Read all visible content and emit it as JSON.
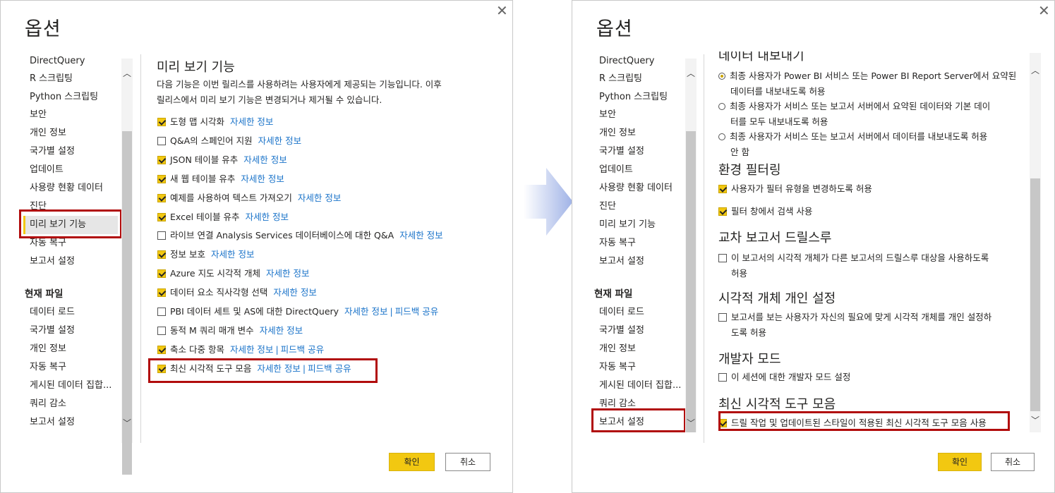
{
  "dialog1": {
    "title": "옵션",
    "nav_global": [
      "DirectQuery",
      "R 스크립팅",
      "Python 스크립팅",
      "보안",
      "개인 정보",
      "국가별 설정",
      "업데이트",
      "사용량 현황 데이터",
      "진단",
      "미리 보기 기능",
      "자동 복구",
      "보고서 설정"
    ],
    "nav_current_header": "현재 파일",
    "nav_current": [
      "데이터 로드",
      "국가별 설정",
      "개인 정보",
      "자동 복구",
      "게시된 데이터 집합...",
      "쿼리 감소",
      "보고서 설정"
    ],
    "selected_nav": "미리 보기 기능",
    "section_title": "미리 보기 기능",
    "description": [
      "다음 기능은 이번 릴리스를 사용하려는 사용자에게 제공되는 기능입니다. 이후",
      "릴리스에서 미리 보기 기능은 변경되거나 제거될 수 있습니다."
    ],
    "features": [
      {
        "label": "도형 맵 시각화",
        "checked": true,
        "link": "자세한 정보",
        "feedback": ""
      },
      {
        "label": "Q&A의 스페인어 지원",
        "checked": false,
        "link": "자세한 정보",
        "feedback": ""
      },
      {
        "label": "JSON 테이블 유추",
        "checked": true,
        "link": "자세한 정보",
        "feedback": ""
      },
      {
        "label": "새 웹 테이블 유추",
        "checked": true,
        "link": "자세한 정보",
        "feedback": ""
      },
      {
        "label": "예제를 사용하여 텍스트 가져오기",
        "checked": true,
        "link": "자세한 정보",
        "feedback": ""
      },
      {
        "label": "Excel 테이블 유추",
        "checked": true,
        "link": "자세한 정보",
        "feedback": ""
      },
      {
        "label": "라이브 연결 Analysis Services 데이터베이스에 대한 Q&A",
        "checked": false,
        "link": "자세한 정보",
        "feedback": ""
      },
      {
        "label": "정보 보호",
        "checked": true,
        "link": "자세한 정보",
        "feedback": ""
      },
      {
        "label": "Azure 지도 시각적 개체",
        "checked": true,
        "link": "자세한 정보",
        "feedback": ""
      },
      {
        "label": "데이터 요소 직사각형 선택",
        "checked": true,
        "link": "자세한 정보",
        "feedback": ""
      },
      {
        "label": "PBI 데이터 세트 및 AS에 대한 DirectQuery",
        "checked": false,
        "link": "자세한 정보",
        "feedback": "피드백 공유"
      },
      {
        "label": "동적 M 쿼리 매개 변수",
        "checked": false,
        "link": "자세한 정보",
        "feedback": ""
      },
      {
        "label": "축소 다중 항목",
        "checked": true,
        "link": "자세한 정보",
        "feedback": "피드백 공유"
      },
      {
        "label": "최신 시각적 도구 모음",
        "checked": true,
        "link": "자세한 정보",
        "feedback": "피드백 공유"
      }
    ],
    "ok_label": "확인",
    "cancel_label": "취소"
  },
  "dialog2": {
    "title": "옵션",
    "nav_global": [
      "DirectQuery",
      "R 스크립팅",
      "Python 스크립팅",
      "보안",
      "개인 정보",
      "국가별 설정",
      "업데이트",
      "사용량 현황 데이터",
      "진단",
      "미리 보기 기능",
      "자동 복구",
      "보고서 설정"
    ],
    "nav_current_header": "현재 파일",
    "nav_current": [
      "데이터 로드",
      "국가별 설정",
      "개인 정보",
      "자동 복구",
      "게시된 데이터 집합...",
      "쿼리 감소",
      "보고서 설정"
    ],
    "selected_nav": "보고서 설정",
    "partial_title": "데이터 내보내기",
    "export_options": [
      {
        "lines": [
          "최종 사용자가 Power BI 서비스 또는 Power BI Report Server에서 요약된",
          "데이터를 내보내도록 허용"
        ],
        "selected": true
      },
      {
        "lines": [
          "최종 사용자가 서비스 또는 보고서 서버에서 요약된 데이터와 기본 데이",
          "터를 모두 내보내도록 허용"
        ],
        "selected": false
      },
      {
        "lines": [
          "최종 사용자가 서비스 또는 보고서 서버에서 데이터를 내보내도록 허용",
          "안 함"
        ],
        "selected": false
      }
    ],
    "filter_title": "환경 필터링",
    "filter_options": [
      {
        "label": "사용자가 필터 유형을 변경하도록 허용",
        "checked": true
      },
      {
        "label": "필터 창에서 검색 사용",
        "checked": true
      }
    ],
    "drill_title": "교차 보고서 드릴스루",
    "drill_option": {
      "lines": [
        "이 보고서의 시각적 개체가 다른 보고서의 드릴스루 대상을 사용하도록",
        "허용"
      ],
      "checked": false
    },
    "personalize_title": "시각적 개체 개인 설정",
    "personalize_option": {
      "lines": [
        "보고서를 보는 사용자가 자신의 필요에 맞게 시각적 개체를 개인 설정하",
        "도록 허용"
      ],
      "checked": false
    },
    "dev_title": "개발자 모드",
    "dev_option": {
      "label": "이 세션에 대한 개발자 모드 설정",
      "checked": false
    },
    "toolbar_title": "최신 시각적 도구 모음",
    "toolbar_option": {
      "label": "드릴 작업 및 업데이트된 스타일이 적용된 최신 시각적 도구 모음 사용",
      "checked": true
    },
    "ok_label": "확인",
    "cancel_label": "취소"
  },
  "colors": {
    "accent": "#f2c811",
    "link": "#1a73c9",
    "highlight": "#b10c0c",
    "arrow": "#a9b8e8"
  },
  "icons": {
    "close": "close-icon",
    "scroll_up": "chevron-up-icon",
    "scroll_down": "chevron-down-icon",
    "arrow": "right-arrow-icon"
  }
}
